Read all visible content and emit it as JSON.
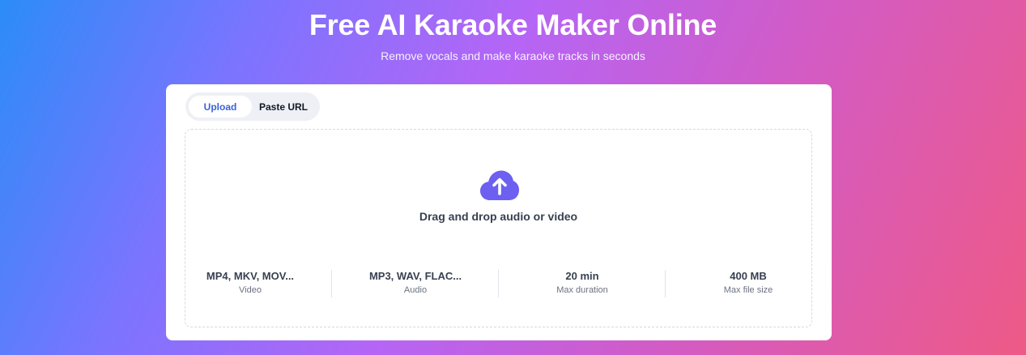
{
  "hero": {
    "title": "Free AI Karaoke Maker Online",
    "subtitle": "Remove vocals and make karaoke tracks in seconds"
  },
  "tabs": [
    {
      "label": "Upload",
      "active": true
    },
    {
      "label": "Paste URL",
      "active": false
    }
  ],
  "dropzone": {
    "prompt": "Drag and drop audio or video",
    "icon": "cloud-upload-icon",
    "icon_color": "#6d5ff0"
  },
  "stats": [
    {
      "value": "MP4, MKV, MOV...",
      "label": "Video"
    },
    {
      "value": "MP3, WAV, FLAC...",
      "label": "Audio"
    },
    {
      "value": "20 min",
      "label": "Max duration"
    },
    {
      "value": "400 MB",
      "label": "Max file size"
    }
  ],
  "colors": {
    "accent": "#3a63d8",
    "icon": "#6d5ff0",
    "gradient_start": "#2b8cf8",
    "gradient_end": "#ee5a86"
  }
}
